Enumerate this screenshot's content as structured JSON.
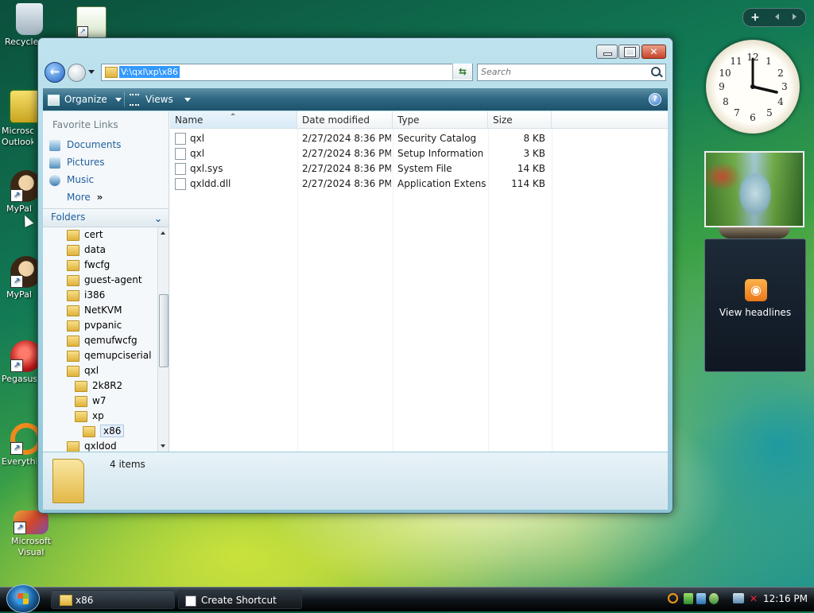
{
  "desktop": {
    "icons": [
      {
        "label": "Recycle Bin"
      },
      {
        "label": "Microsoft Outlook"
      },
      {
        "label": "MyPal"
      },
      {
        "label": "MyPal"
      },
      {
        "label": "Pegasus"
      },
      {
        "label": "Everything"
      },
      {
        "label": "Microsoft Visual Stud..."
      }
    ]
  },
  "window": {
    "address": "V:\\qxl\\xp\\x86",
    "search_placeholder": "Search",
    "toolbar": {
      "organize": "Organize",
      "views": "Views"
    },
    "favorites": {
      "title": "Favorite Links",
      "items": [
        "Documents",
        "Pictures",
        "Music"
      ],
      "more": "More"
    },
    "folders": {
      "title": "Folders",
      "tree": [
        {
          "label": "cert",
          "level": 0
        },
        {
          "label": "data",
          "level": 0
        },
        {
          "label": "fwcfg",
          "level": 0
        },
        {
          "label": "guest-agent",
          "level": 0
        },
        {
          "label": "i386",
          "level": 0
        },
        {
          "label": "NetKVM",
          "level": 0
        },
        {
          "label": "pvpanic",
          "level": 0
        },
        {
          "label": "qemufwcfg",
          "level": 0
        },
        {
          "label": "qemupciserial",
          "level": 0
        },
        {
          "label": "qxl",
          "level": 0
        },
        {
          "label": "2k8R2",
          "level": 1
        },
        {
          "label": "w7",
          "level": 1
        },
        {
          "label": "xp",
          "level": 1
        },
        {
          "label": "x86",
          "level": 2,
          "selected": true
        },
        {
          "label": "qxldod",
          "level": 0
        }
      ]
    },
    "columns": [
      "Name",
      "Date modified",
      "Type",
      "Size"
    ],
    "files": [
      {
        "name": "qxl",
        "date": "2/27/2024 8:36 PM",
        "type": "Security Catalog",
        "size": "8 KB"
      },
      {
        "name": "qxl",
        "date": "2/27/2024 8:36 PM",
        "type": "Setup Information",
        "size": "3 KB"
      },
      {
        "name": "qxl.sys",
        "date": "2/27/2024 8:36 PM",
        "type": "System File",
        "size": "14 KB"
      },
      {
        "name": "qxldd.dll",
        "date": "2/27/2024 8:36 PM",
        "type": "Application Extens...",
        "size": "114 KB"
      }
    ],
    "status": "4 items"
  },
  "gadgets": {
    "feed_label": "View headlines"
  },
  "taskbar": {
    "tasks": [
      "x86",
      "Create Shortcut"
    ],
    "clock": "12:16 PM"
  }
}
